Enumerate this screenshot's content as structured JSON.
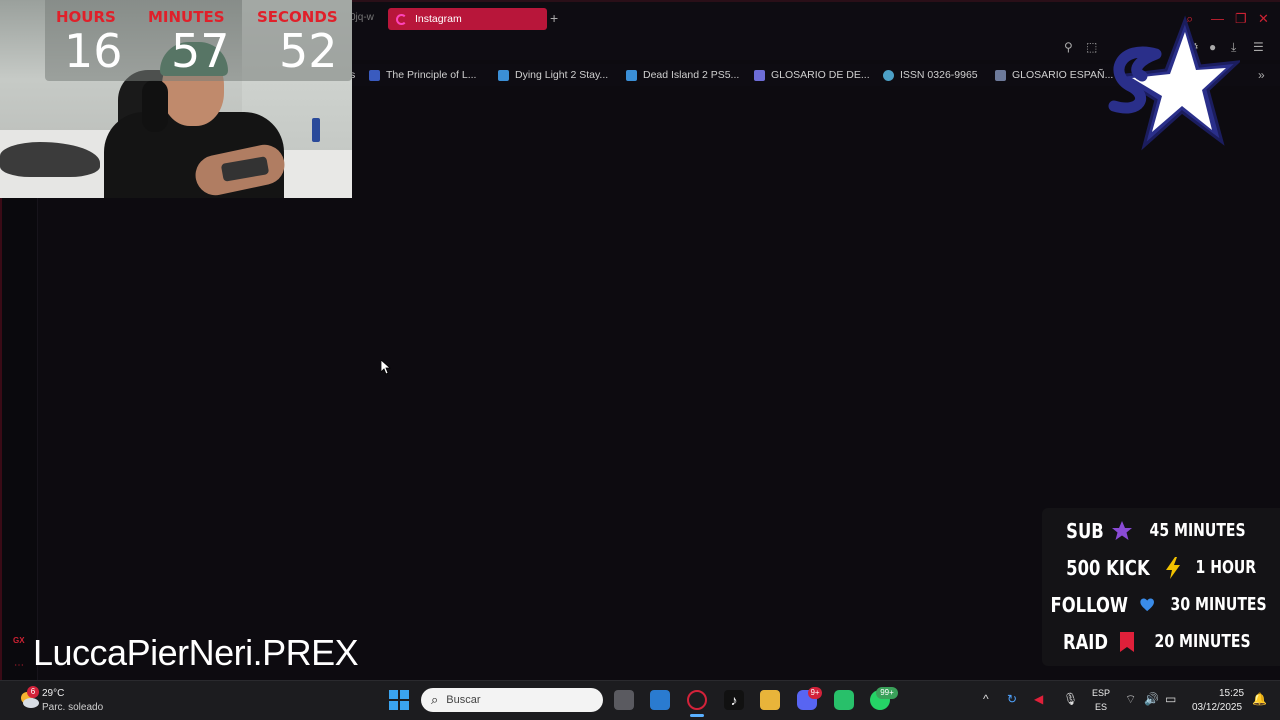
{
  "browser": {
    "prev_tab_fragment": "0jq-w",
    "active_tab": "Instagram",
    "new_tab_symbol": "+"
  },
  "bookmarks": [
    {
      "label": "s",
      "color": "#777777"
    },
    {
      "label": "The Principle of L...",
      "color": "#3a5bbf"
    },
    {
      "label": "Dying Light 2 Stay...",
      "color": "#3b8fd6"
    },
    {
      "label": "Dead Island 2 PS5...",
      "color": "#3b8fd6"
    },
    {
      "label": "GLOSARIO DE DE...",
      "color": "#6d6dd6"
    },
    {
      "label": "ISSN 0326-9965",
      "color": "#4ca0c6"
    },
    {
      "label": "GLOSARIO ESPAÑ...",
      "color": "#6d7a9a"
    }
  ],
  "timer": {
    "hours_label": "HOURS",
    "minutes_label": "MINUTES",
    "seconds_label": "SECONDS",
    "hours": "16",
    "minutes": "57",
    "seconds": "52"
  },
  "rules": [
    {
      "key": "SUB",
      "value": "45 MINUTES",
      "icon": "star-icon",
      "color": "#8a4bd6"
    },
    {
      "key": "500 KICK",
      "value": "1 HOUR",
      "icon": "lightning-icon",
      "color": "#f2c200"
    },
    {
      "key": "FOLLOW",
      "value": "30 MINUTES",
      "icon": "heart-icon",
      "color": "#3a8be8"
    },
    {
      "key": "RAID",
      "value": "20 MINUTES",
      "icon": "bookmark-icon",
      "color": "#e0203a"
    }
  ],
  "overlay": {
    "handle": "LuccaPierNeri.PREX",
    "gx_label": "GX"
  },
  "taskbar": {
    "weather_badge": "6",
    "temperature": "29°C",
    "weather_desc": "Parc. soleado",
    "search_placeholder": "Buscar",
    "discord_badge": "9+",
    "whatsapp_badge": "99+",
    "lang_top": "ESP",
    "lang_bottom": "ES",
    "time": "15:25",
    "date": "03/12/2025"
  },
  "colors": {
    "accent_red": "#b8163a",
    "background": "#0d0b10"
  }
}
